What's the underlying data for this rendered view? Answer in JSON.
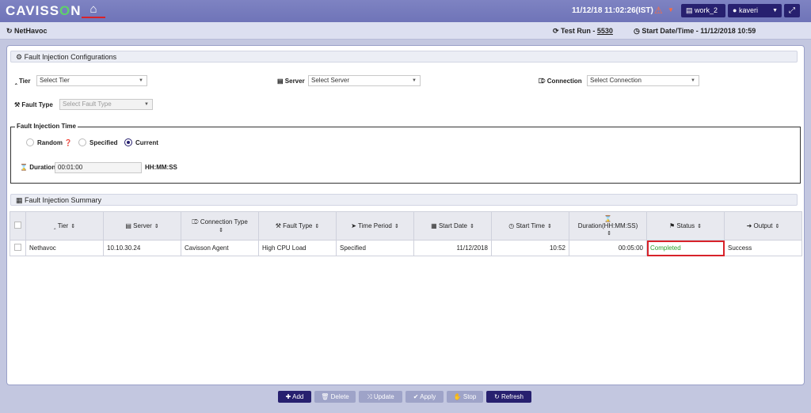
{
  "app": {
    "logo_left": "CAVISS",
    "logo_o": "O",
    "logo_right": "N",
    "datetime": "11/12/18 11:02:26(IST)",
    "work_button": "work_2",
    "user_button": "kaveri"
  },
  "subbar": {
    "title": "NetHavoc",
    "test_run_label": "Test Run - ",
    "test_run_value": "5530",
    "start_label": "Start Date/Time - 11/12/2018 10:59"
  },
  "config": {
    "header": "Fault Injection Configurations",
    "tier_label": "Tier",
    "tier_placeholder": "Select Tier",
    "server_label": "Server",
    "server_placeholder": "Select Server",
    "connection_label": "Connection",
    "connection_placeholder": "Select Connection",
    "fault_label": "Fault Type",
    "fault_placeholder": "Select Fault Type",
    "time_legend": "Fault Injection Time",
    "radio_random": "Random",
    "radio_specified": "Specified",
    "radio_current": "Current",
    "duration_label": "Duration",
    "duration_value": "00:01:00",
    "duration_format": "HH:MM:SS"
  },
  "summary": {
    "header": "Fault Injection Summary",
    "columns": [
      "Tier",
      "Server",
      "Connection Type",
      "Fault Type",
      "Time Period",
      "Start Date",
      "Start Time",
      "Duration(HH:MM:SS)",
      "Status",
      "Output"
    ],
    "rows": [
      {
        "tier": "Nethavoc",
        "server": "10.10.30.24",
        "connection": "Cavisson Agent",
        "fault": "High CPU Load",
        "period": "Specified",
        "start_date": "11/12/2018",
        "start_time": "10:52",
        "duration": "00:05:00",
        "status": "Completed",
        "output": "Success"
      }
    ]
  },
  "actions": {
    "add": "Add",
    "delete": "Delete",
    "update": "Update",
    "apply": "Apply",
    "stop": "Stop",
    "refresh": "Refresh"
  },
  "colors": {
    "accent": "#27206f",
    "status_ok": "#2ca02c",
    "highlight": "#d8232a"
  }
}
